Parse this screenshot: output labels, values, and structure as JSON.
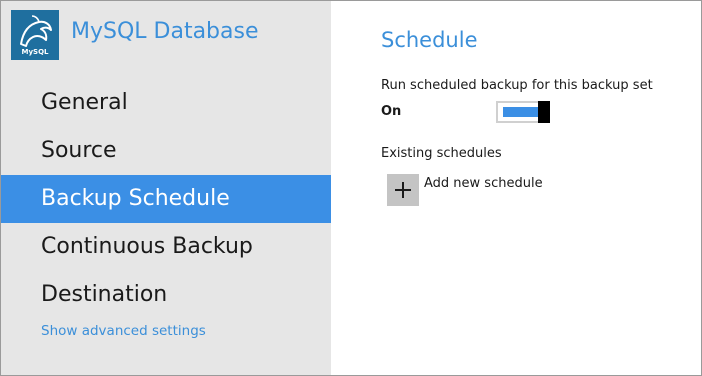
{
  "app": {
    "title": "MySQL Database",
    "logo_text": "MySQL",
    "logo_icon": "mysql-dolphin-icon"
  },
  "sidebar": {
    "items": [
      {
        "label": "General",
        "active": false
      },
      {
        "label": "Source",
        "active": false
      },
      {
        "label": "Backup Schedule",
        "active": true
      },
      {
        "label": "Continuous Backup",
        "active": false
      },
      {
        "label": "Destination",
        "active": false
      }
    ],
    "advanced_link": "Show advanced settings"
  },
  "schedule": {
    "title": "Schedule",
    "run_label": "Run scheduled backup for this backup set",
    "toggle_state": "On",
    "toggle_on": true,
    "existing_label": "Existing schedules",
    "add_label": "Add new schedule",
    "add_icon": "plus-icon"
  },
  "colors": {
    "accent": "#3b8fe5",
    "link": "#3b8fd9",
    "sidebar_bg": "#e6e6e6",
    "logo_bg": "#1f6f9f",
    "add_button_bg": "#c4c4c4"
  }
}
